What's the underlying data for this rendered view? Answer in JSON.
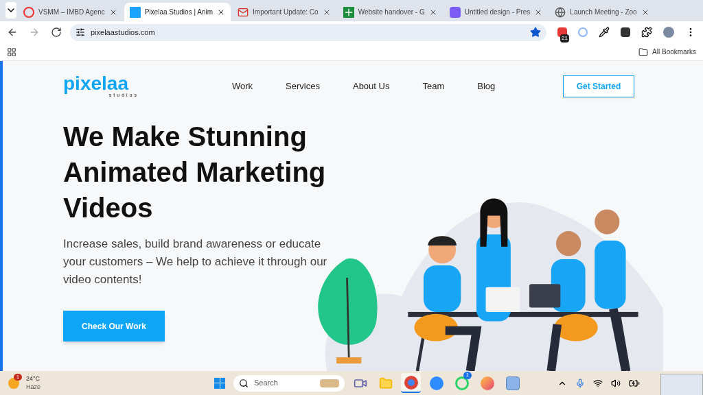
{
  "browser": {
    "tabs": [
      {
        "title": "VSMM – IMBD Agenc",
        "selected": false,
        "kind": "alert"
      },
      {
        "title": "Pixelaa Studios | Anim",
        "selected": true,
        "kind": "pixelaa"
      },
      {
        "title": "Important Update: Co",
        "selected": false,
        "kind": "mail"
      },
      {
        "title": "Website handover - G",
        "selected": false,
        "kind": "sheet"
      },
      {
        "title": "Untitled design - Pres",
        "selected": false,
        "kind": "design"
      },
      {
        "title": "Launch Meeting - Zoo",
        "selected": false,
        "kind": "globe"
      }
    ],
    "url": "pixelaastudios.com",
    "bookmarked": true,
    "extension_badge": "21",
    "bookmarks_label": "All Bookmarks"
  },
  "page": {
    "logo": {
      "name": "pixelaa",
      "tagline": "studios"
    },
    "nav": [
      "Work",
      "Services",
      "About Us",
      "Team",
      "Blog"
    ],
    "cta": "Get Started",
    "headline": "We Make Stunning Animated Marketing Videos",
    "subtext": "Increase sales, build brand awareness or educate your customers – We help to achieve it through our video contents!",
    "button": "Check Our Work"
  },
  "taskbar": {
    "weather": {
      "temp": "24°C",
      "condition": "Haze",
      "badge": "1"
    },
    "search_placeholder": "Search",
    "apps": [
      {
        "kind": "meet",
        "active": false
      },
      {
        "kind": "folder",
        "active": false
      },
      {
        "kind": "chrome",
        "active": true
      },
      {
        "kind": "zoom",
        "active": false
      },
      {
        "kind": "whatsapp",
        "badge": "1",
        "active": false
      },
      {
        "kind": "firefox",
        "active": false
      },
      {
        "kind": "wordpad",
        "active": false
      }
    ]
  }
}
